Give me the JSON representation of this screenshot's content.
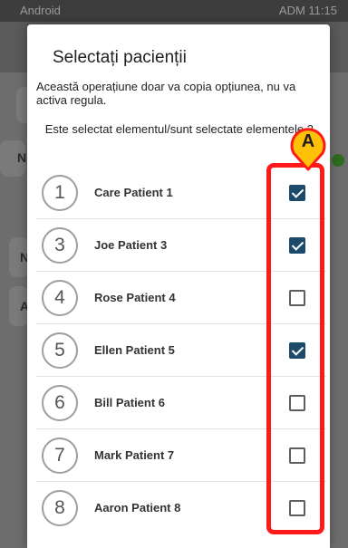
{
  "status_bar": {
    "left": "Android",
    "right": "ADM 11:15"
  },
  "background": {
    "letters": [
      "N",
      "N",
      "A"
    ]
  },
  "dialog": {
    "title": "Selectați pacienții",
    "subtitle": "Această operațiune doar va copia opțiunea, nu va activa regula.",
    "selection_status": "Este selectat elementul/sunt selectate elementele 3"
  },
  "patients": [
    {
      "number": "1",
      "name": "Care Patient 1",
      "checked": true
    },
    {
      "number": "3",
      "name": "Joe Patient 3",
      "checked": true
    },
    {
      "number": "4",
      "name": "Rose Patient 4",
      "checked": false
    },
    {
      "number": "5",
      "name": "Ellen Patient 5",
      "checked": true
    },
    {
      "number": "6",
      "name": "Bill Patient 6",
      "checked": false
    },
    {
      "number": "7",
      "name": "Mark Patient 7",
      "checked": false
    },
    {
      "number": "8",
      "name": "Aaron Patient 8",
      "checked": false
    }
  ],
  "annotation": {
    "label": "A",
    "color": "#ff1a1a",
    "marker_color": "#ffc107"
  },
  "colors": {
    "checkbox_checked": "#1b4a6b"
  }
}
